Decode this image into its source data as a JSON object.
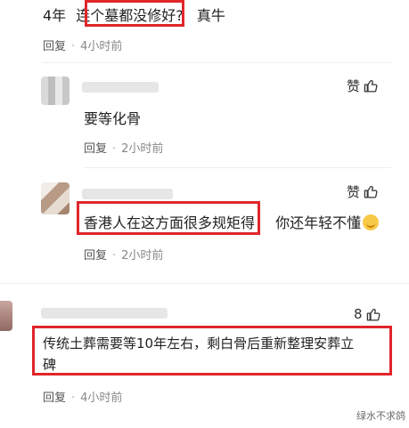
{
  "comments": [
    {
      "prefix": "4年",
      "highlight": "连个墓都没修好?",
      "suffix": "真牛",
      "reply_label": "回复",
      "time": "4小时前"
    },
    {
      "text": "要等化骨",
      "like_label": "赞",
      "reply_label": "回复",
      "time": "2小时前"
    },
    {
      "highlight": "香港人在这方面很多规矩得",
      "suffix": "你还年轻不懂",
      "like_label": "赞",
      "reply_label": "回复",
      "time": "2小时前"
    },
    {
      "line1": "传统土葬需要等10年左右，剩白骨后重新整理安葬立",
      "line2": "碑",
      "like_count": "8",
      "reply_label": "回复",
      "time": "4小时前"
    }
  ],
  "watermark": "绿水不求鸽",
  "colors": {
    "highlight_border": "#e0262b",
    "meta": "#888888"
  }
}
